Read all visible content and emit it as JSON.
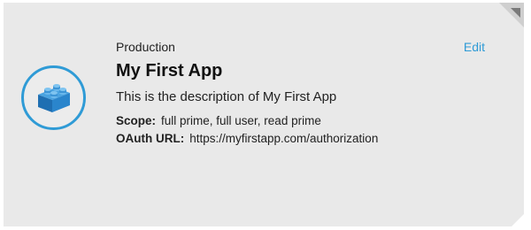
{
  "card": {
    "environment": "Production",
    "edit_label": "Edit",
    "title": "My First App",
    "description": "This is the description of My First App",
    "icon": "lego-brick-icon",
    "corner_icon": "corner-triangle-icon",
    "accent_color": "#2f9bd6",
    "scope": {
      "label": "Scope:",
      "value": "full prime, full user, read prime"
    },
    "oauth": {
      "label": "OAuth URL:",
      "value": "https://myfirstapp.com/authorization"
    }
  }
}
